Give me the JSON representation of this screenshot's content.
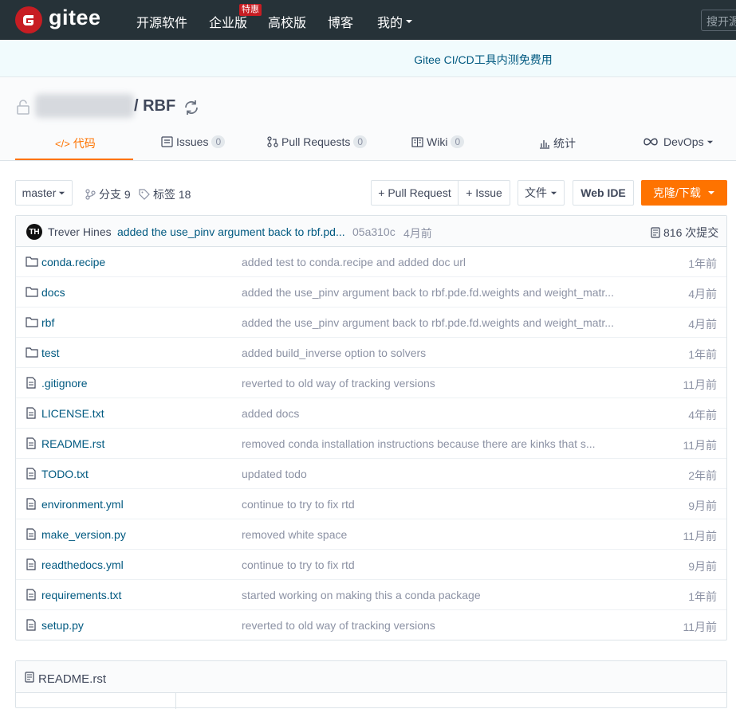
{
  "nav": {
    "logo_text": "gitee",
    "items": [
      "开源软件",
      "企业版",
      "高校版",
      "博客",
      "我的"
    ],
    "hot_badge": "特惠",
    "search_placeholder": "搜开源"
  },
  "banner": {
    "text": "Gitee CI/CD工具内测免费用"
  },
  "repo": {
    "name": "/ RBF",
    "tabs": [
      {
        "label": "代码"
      },
      {
        "label": "Issues",
        "count": "0"
      },
      {
        "label": "Pull Requests",
        "count": "0"
      },
      {
        "label": "Wiki",
        "count": "0"
      },
      {
        "label": "统计"
      },
      {
        "label": "DevOps"
      }
    ]
  },
  "toolbar": {
    "branch": "master",
    "branches": "分支 9",
    "tags": "标签 18",
    "new_pr": "+ Pull Request",
    "new_issue": "+ Issue",
    "files": "文件",
    "web_ide": "Web IDE",
    "clone": "克隆/下载"
  },
  "commit": {
    "avatar": "TH",
    "author": "Trever Hines",
    "message": "added the use_pinv argument back to rbf.pd...",
    "hash": "05a310c",
    "time": "4月前",
    "count": "816 次提交"
  },
  "files": [
    {
      "type": "folder",
      "name": "conda.recipe",
      "msg": "added test to conda.recipe and added doc url",
      "time": "1年前"
    },
    {
      "type": "folder",
      "name": "docs",
      "msg": "added the use_pinv argument back to rbf.pde.fd.weights and weight_matr...",
      "time": "4月前"
    },
    {
      "type": "folder",
      "name": "rbf",
      "msg": "added the use_pinv argument back to rbf.pde.fd.weights and weight_matr...",
      "time": "4月前"
    },
    {
      "type": "folder",
      "name": "test",
      "msg": "added build_inverse option to solvers",
      "time": "1年前"
    },
    {
      "type": "file",
      "name": ".gitignore",
      "msg": "reverted to old way of tracking versions",
      "time": "11月前"
    },
    {
      "type": "file",
      "name": "LICENSE.txt",
      "msg": "added docs",
      "time": "4年前"
    },
    {
      "type": "file",
      "name": "README.rst",
      "msg": "removed conda installation instructions because there are kinks that s...",
      "time": "11月前"
    },
    {
      "type": "file",
      "name": "TODO.txt",
      "msg": "updated todo",
      "time": "2年前"
    },
    {
      "type": "file",
      "name": "environment.yml",
      "msg": "continue to try to fix rtd",
      "time": "9月前"
    },
    {
      "type": "file",
      "name": "make_version.py",
      "msg": "removed white space",
      "time": "11月前"
    },
    {
      "type": "file",
      "name": "readthedocs.yml",
      "msg": "continue to try to fix rtd",
      "time": "9月前"
    },
    {
      "type": "file",
      "name": "requirements.txt",
      "msg": "started working on making this a conda package",
      "time": "1年前"
    },
    {
      "type": "file",
      "name": "setup.py",
      "msg": "reverted to old way of tracking versions",
      "time": "11月前"
    }
  ],
  "readme": {
    "title": "README.rst"
  }
}
